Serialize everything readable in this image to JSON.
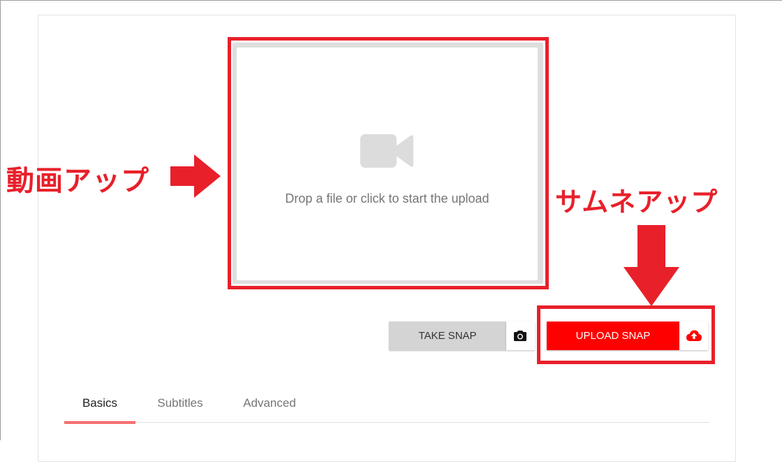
{
  "dropzone": {
    "icon": "video-camera-icon",
    "text": "Drop a file or click to start the upload"
  },
  "annotations": {
    "video_upload": "動画アップ",
    "thumbnail_upload": "サムネアップ",
    "color": "#e8202a"
  },
  "actions": {
    "take_snap_label": "TAKE SNAP",
    "take_snap_icon": "camera-icon",
    "upload_snap_label": "UPLOAD SNAP",
    "upload_snap_icon": "cloud-upload-icon"
  },
  "tabs": [
    {
      "label": "Basics",
      "active": true
    },
    {
      "label": "Subtitles",
      "active": false
    },
    {
      "label": "Advanced",
      "active": false
    }
  ],
  "colors": {
    "accent": "#ff0000",
    "secondary_button": "#d4d4d4",
    "dropzone_border": "#dedede",
    "muted_text": "#757575"
  }
}
